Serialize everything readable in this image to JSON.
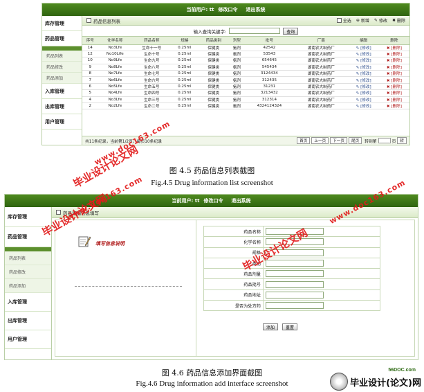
{
  "shot1": {
    "topbar": {
      "user_label": "当前用户: tt",
      "change_pwd": "修改口令",
      "logout": "退出系统"
    },
    "sidebar": {
      "groups": [
        "库存管理",
        "药品管理",
        "入库管理",
        "出库管理",
        "用户管理"
      ],
      "sub_items": [
        "药品列表",
        "药品修改",
        "药品添加"
      ]
    },
    "title": "药品信息列表",
    "toolbar": {
      "select_all": "全选",
      "add": "新增",
      "edit": "修改",
      "delete": "删除"
    },
    "search": {
      "label": "输入查询关键字:",
      "value": "",
      "button": "查询"
    },
    "table": {
      "headers": [
        "序号",
        "化学名称",
        "药品名称",
        "规格",
        "药品类别",
        "剂型",
        "批号",
        "厂商",
        "编辑",
        "删除"
      ],
      "rows": [
        [
          "14",
          "No3Lfe",
          "生命十一号",
          "0.25ml",
          "保健类",
          "氨剂",
          "42542",
          "湖南农大制药厂",
          "[修改]",
          "[删除]"
        ],
        [
          "12",
          "No10Life",
          "生命十号",
          "0.25ml",
          "保健类",
          "氨剂",
          "53543",
          "湖南农大制药厂",
          "[修改]",
          "[删除]"
        ],
        [
          "10",
          "No9Lfe",
          "生命九号",
          "0.25ml",
          "保健类",
          "氨剂",
          "654645",
          "湖南农大制药厂",
          "[修改]",
          "[删除]"
        ],
        [
          "9",
          "No8Lfe",
          "生命八号",
          "0.25ml",
          "保健类",
          "氨剂",
          "545434",
          "湖南农大制药厂",
          "[修改]",
          "[删除]"
        ],
        [
          "8",
          "No7Lfe",
          "生命七号",
          "0.25ml",
          "保健类",
          "氨剂",
          "3124434",
          "湖南农大制药厂",
          "[修改]",
          "[删除]"
        ],
        [
          "7",
          "No6Lfe",
          "生命六号",
          "0.25ml",
          "保健类",
          "氨剂",
          "312435",
          "湖南农大制药厂",
          "[修改]",
          "[删除]"
        ],
        [
          "6",
          "No5Lfe",
          "生命五号",
          "0.25ml",
          "保健类",
          "氨剂",
          "31231",
          "湖南农大制药厂",
          "[修改]",
          "[删除]"
        ],
        [
          "5",
          "No4Lfe",
          "生命四号",
          "0.25ml",
          "保健类",
          "氨剂",
          "3213432",
          "湖南农大制药厂",
          "[修改]",
          "[删除]"
        ],
        [
          "4",
          "No3Lfe",
          "生命三号",
          "0.25ml",
          "保健类",
          "氨剂",
          "312314",
          "湖南农大制药厂",
          "[修改]",
          "[删除]"
        ],
        [
          "2",
          "No2Lfe",
          "生命二号",
          "0.25ml",
          "保健类",
          "氨剂",
          "4324124324",
          "湖南农大制药厂",
          "[修改]",
          "[删除]"
        ]
      ]
    },
    "pager": {
      "info": "共11条纪录，当前第1/2页，每页10条纪录",
      "first": "首页",
      "prev": "上一页",
      "next": "下一页",
      "last": "尾页",
      "goto": "转到第",
      "page_unit": "页",
      "go": "转"
    }
  },
  "caption1": {
    "zh": "图 4.5  药品信息列表截图",
    "en": "Fig.4.5    Drug information list screenshot"
  },
  "shot2": {
    "topbar": {
      "user_label": "当前用户: tt",
      "change_pwd": "修改口令",
      "logout": "退出系统"
    },
    "sidebar": {
      "groups": [
        "库存管理",
        "药品管理",
        "入库管理",
        "出库管理",
        "用户管理"
      ],
      "sub_items": [
        "药品列表",
        "药品修改",
        "药品添加"
      ]
    },
    "title": "药品添加信息填写",
    "note": "填写信息说明",
    "form": {
      "fields": [
        "药品名称",
        "化学名称",
        "规格",
        "类别",
        "药品剂量",
        "药品批号",
        "药品地址",
        "是否为处方药"
      ],
      "submit": "添加",
      "reset": "重置"
    }
  },
  "caption2": {
    "zh": "图 4.6  药品信息添加界面截图",
    "en": "Fig.4.6    Drug information add interface screenshot"
  },
  "watermarks": {
    "cn": "毕业设计论文网",
    "url": "www.doc163.com"
  },
  "footer_logo": {
    "site": "56DOC.com",
    "text": "毕业设计(论文)网"
  }
}
